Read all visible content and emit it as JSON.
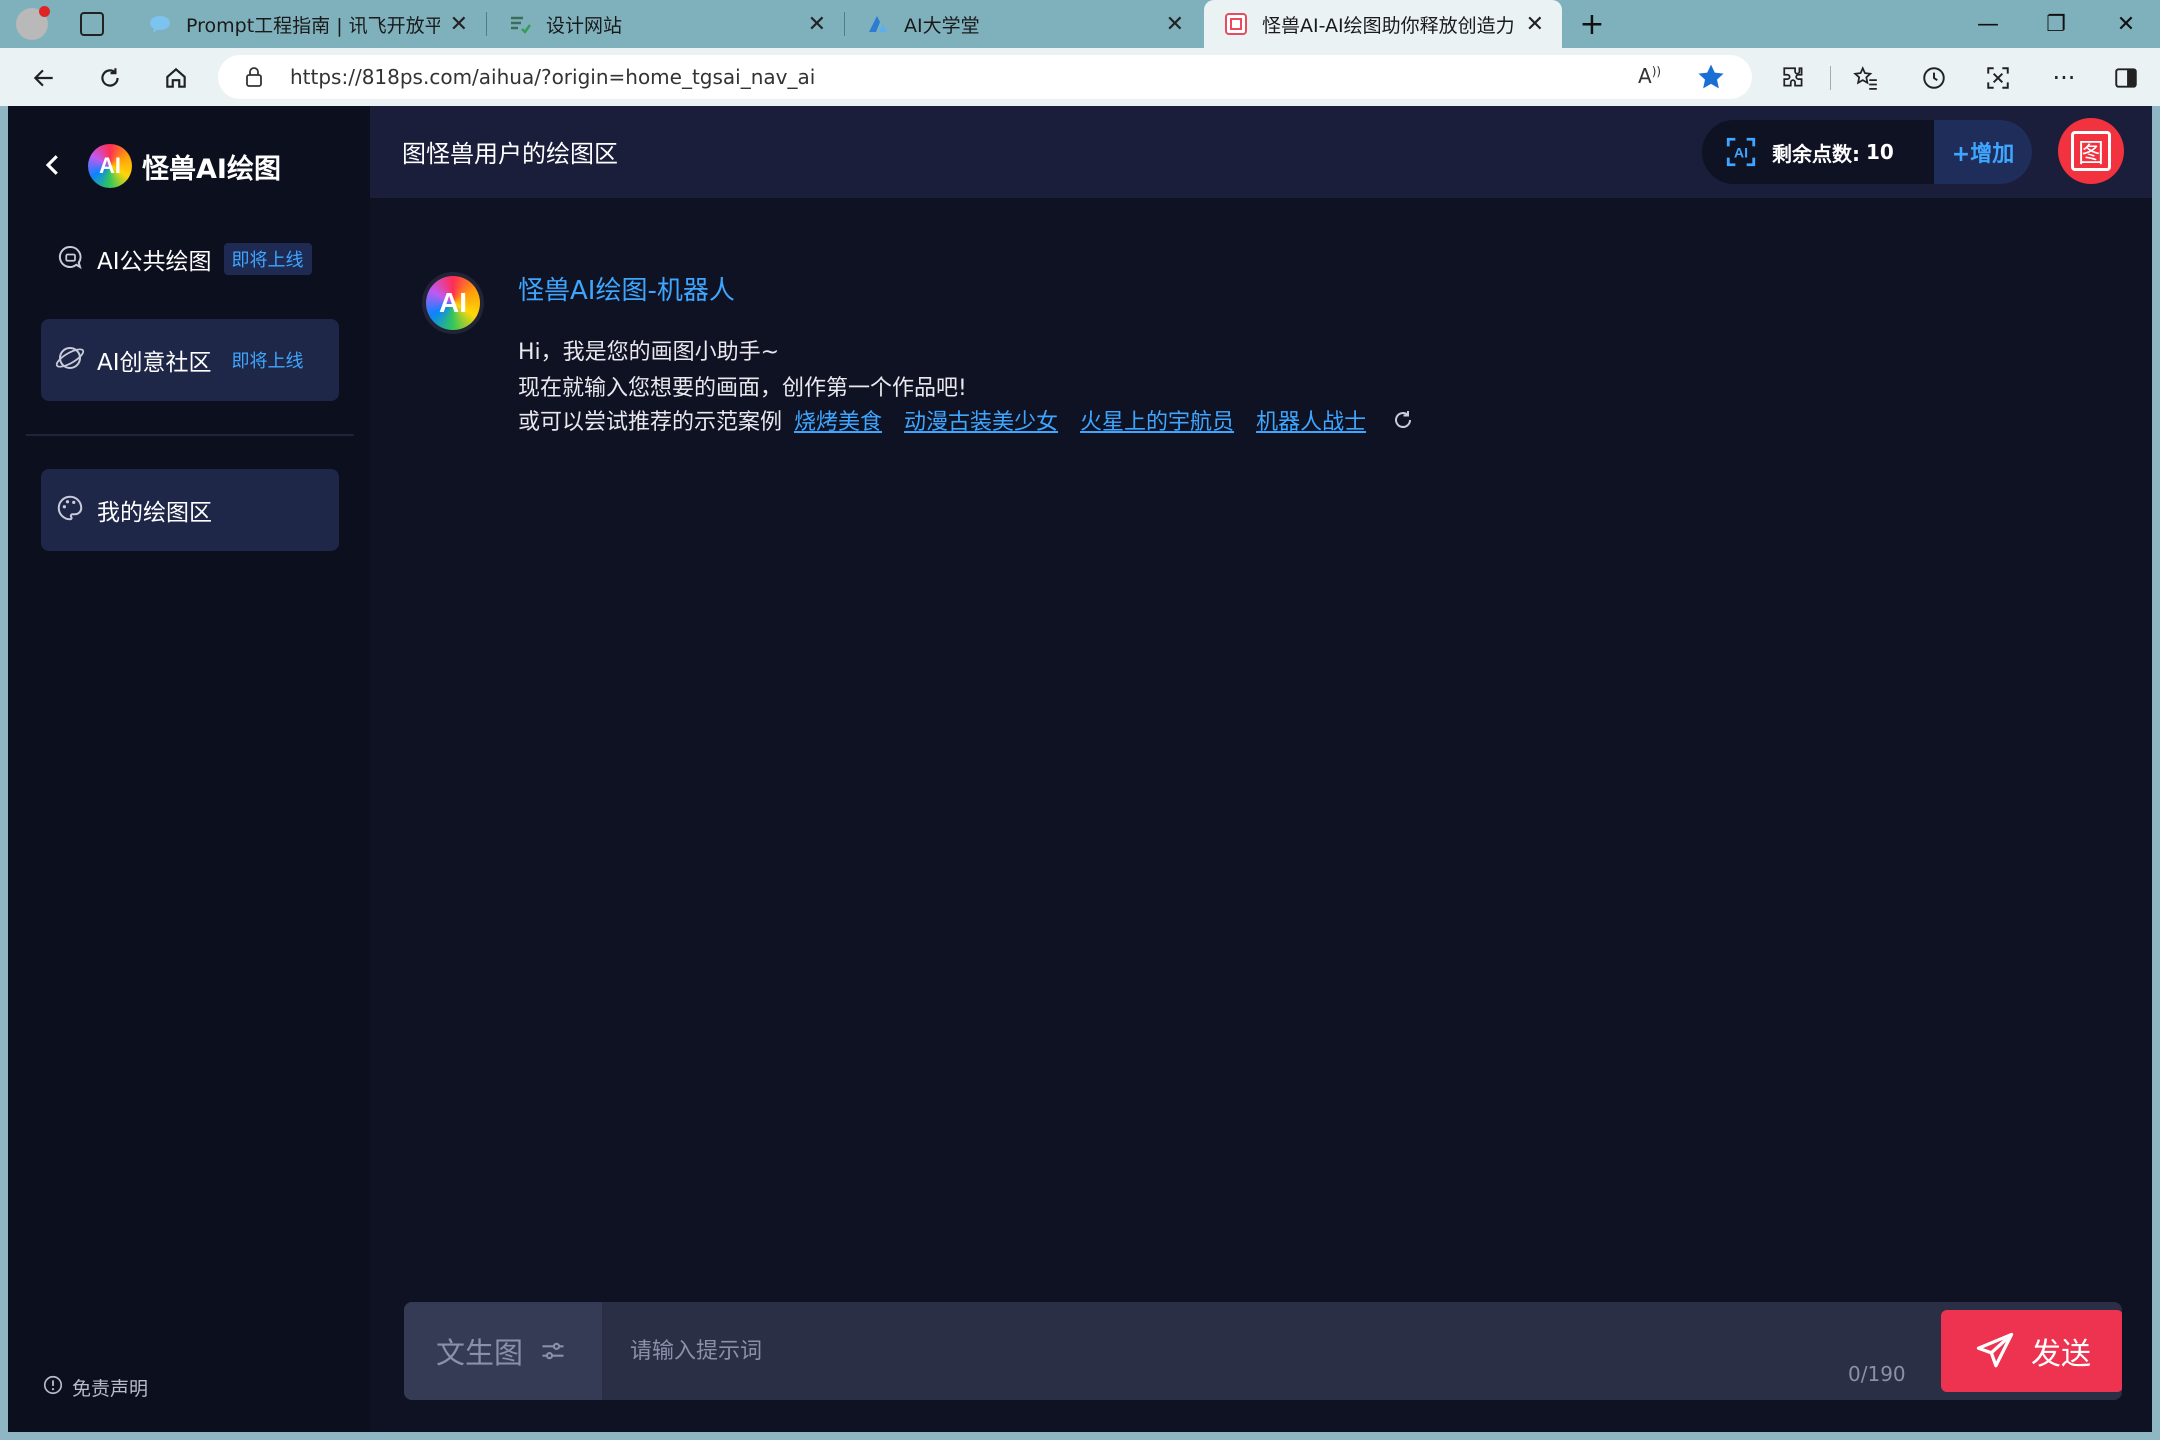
{
  "browser": {
    "tabs": [
      {
        "title": "Prompt工程指南 | 讯飞开放平台"
      },
      {
        "title": "设计网站"
      },
      {
        "title": "AI大学堂"
      },
      {
        "title": "怪兽AI-AI绘图助你释放创造力"
      }
    ],
    "url": "https://818ps.com/aihua/?origin=home_tgsai_nav_ai"
  },
  "sidebar": {
    "app_name": "怪兽AI绘图",
    "logo_text": "AI",
    "items": [
      {
        "label": "AI公共绘图",
        "badge": "即将上线"
      },
      {
        "label": "AI创意社区",
        "badge": "即将上线"
      },
      {
        "label": "我的绘图区"
      }
    ],
    "disclaimer": "免责声明"
  },
  "header": {
    "title": "图怪兽用户的绘图区",
    "points_label": "剩余点数:",
    "points_value": "10",
    "add_label": "+增加",
    "avatar_char": "图"
  },
  "chat": {
    "bot_name": "怪兽AI绘图-机器人",
    "bot_logo": "AI",
    "lines": [
      "Hi，我是您的画图小助手~",
      "现在就输入您想要的画面，创作第一个作品吧!"
    ],
    "examples_lead": "或可以尝试推荐的示范案例",
    "examples": [
      "烧烤美食",
      "动漫古装美少女",
      "火星上的宇航员",
      "机器人战士"
    ]
  },
  "composer": {
    "mode_label": "文生图",
    "placeholder": "请输入提示词",
    "counter": "0/190",
    "send_label": "发送"
  },
  "colors": {
    "accent_blue": "#3ea6ff",
    "send_red": "#ee3350",
    "background": "#0f1223"
  }
}
